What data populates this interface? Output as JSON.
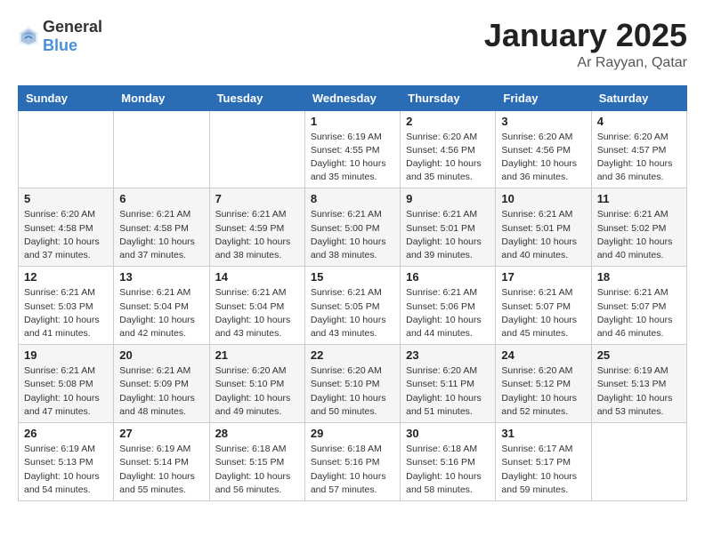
{
  "header": {
    "logo_general": "General",
    "logo_blue": "Blue",
    "title": "January 2025",
    "subtitle": "Ar Rayyan, Qatar"
  },
  "weekdays": [
    "Sunday",
    "Monday",
    "Tuesday",
    "Wednesday",
    "Thursday",
    "Friday",
    "Saturday"
  ],
  "weeks": [
    [
      {
        "day": "",
        "sunrise": "",
        "sunset": "",
        "daylight": ""
      },
      {
        "day": "",
        "sunrise": "",
        "sunset": "",
        "daylight": ""
      },
      {
        "day": "",
        "sunrise": "",
        "sunset": "",
        "daylight": ""
      },
      {
        "day": "1",
        "sunrise": "Sunrise: 6:19 AM",
        "sunset": "Sunset: 4:55 PM",
        "daylight": "Daylight: 10 hours and 35 minutes."
      },
      {
        "day": "2",
        "sunrise": "Sunrise: 6:20 AM",
        "sunset": "Sunset: 4:56 PM",
        "daylight": "Daylight: 10 hours and 35 minutes."
      },
      {
        "day": "3",
        "sunrise": "Sunrise: 6:20 AM",
        "sunset": "Sunset: 4:56 PM",
        "daylight": "Daylight: 10 hours and 36 minutes."
      },
      {
        "day": "4",
        "sunrise": "Sunrise: 6:20 AM",
        "sunset": "Sunset: 4:57 PM",
        "daylight": "Daylight: 10 hours and 36 minutes."
      }
    ],
    [
      {
        "day": "5",
        "sunrise": "Sunrise: 6:20 AM",
        "sunset": "Sunset: 4:58 PM",
        "daylight": "Daylight: 10 hours and 37 minutes."
      },
      {
        "day": "6",
        "sunrise": "Sunrise: 6:21 AM",
        "sunset": "Sunset: 4:58 PM",
        "daylight": "Daylight: 10 hours and 37 minutes."
      },
      {
        "day": "7",
        "sunrise": "Sunrise: 6:21 AM",
        "sunset": "Sunset: 4:59 PM",
        "daylight": "Daylight: 10 hours and 38 minutes."
      },
      {
        "day": "8",
        "sunrise": "Sunrise: 6:21 AM",
        "sunset": "Sunset: 5:00 PM",
        "daylight": "Daylight: 10 hours and 38 minutes."
      },
      {
        "day": "9",
        "sunrise": "Sunrise: 6:21 AM",
        "sunset": "Sunset: 5:01 PM",
        "daylight": "Daylight: 10 hours and 39 minutes."
      },
      {
        "day": "10",
        "sunrise": "Sunrise: 6:21 AM",
        "sunset": "Sunset: 5:01 PM",
        "daylight": "Daylight: 10 hours and 40 minutes."
      },
      {
        "day": "11",
        "sunrise": "Sunrise: 6:21 AM",
        "sunset": "Sunset: 5:02 PM",
        "daylight": "Daylight: 10 hours and 40 minutes."
      }
    ],
    [
      {
        "day": "12",
        "sunrise": "Sunrise: 6:21 AM",
        "sunset": "Sunset: 5:03 PM",
        "daylight": "Daylight: 10 hours and 41 minutes."
      },
      {
        "day": "13",
        "sunrise": "Sunrise: 6:21 AM",
        "sunset": "Sunset: 5:04 PM",
        "daylight": "Daylight: 10 hours and 42 minutes."
      },
      {
        "day": "14",
        "sunrise": "Sunrise: 6:21 AM",
        "sunset": "Sunset: 5:04 PM",
        "daylight": "Daylight: 10 hours and 43 minutes."
      },
      {
        "day": "15",
        "sunrise": "Sunrise: 6:21 AM",
        "sunset": "Sunset: 5:05 PM",
        "daylight": "Daylight: 10 hours and 43 minutes."
      },
      {
        "day": "16",
        "sunrise": "Sunrise: 6:21 AM",
        "sunset": "Sunset: 5:06 PM",
        "daylight": "Daylight: 10 hours and 44 minutes."
      },
      {
        "day": "17",
        "sunrise": "Sunrise: 6:21 AM",
        "sunset": "Sunset: 5:07 PM",
        "daylight": "Daylight: 10 hours and 45 minutes."
      },
      {
        "day": "18",
        "sunrise": "Sunrise: 6:21 AM",
        "sunset": "Sunset: 5:07 PM",
        "daylight": "Daylight: 10 hours and 46 minutes."
      }
    ],
    [
      {
        "day": "19",
        "sunrise": "Sunrise: 6:21 AM",
        "sunset": "Sunset: 5:08 PM",
        "daylight": "Daylight: 10 hours and 47 minutes."
      },
      {
        "day": "20",
        "sunrise": "Sunrise: 6:21 AM",
        "sunset": "Sunset: 5:09 PM",
        "daylight": "Daylight: 10 hours and 48 minutes."
      },
      {
        "day": "21",
        "sunrise": "Sunrise: 6:20 AM",
        "sunset": "Sunset: 5:10 PM",
        "daylight": "Daylight: 10 hours and 49 minutes."
      },
      {
        "day": "22",
        "sunrise": "Sunrise: 6:20 AM",
        "sunset": "Sunset: 5:10 PM",
        "daylight": "Daylight: 10 hours and 50 minutes."
      },
      {
        "day": "23",
        "sunrise": "Sunrise: 6:20 AM",
        "sunset": "Sunset: 5:11 PM",
        "daylight": "Daylight: 10 hours and 51 minutes."
      },
      {
        "day": "24",
        "sunrise": "Sunrise: 6:20 AM",
        "sunset": "Sunset: 5:12 PM",
        "daylight": "Daylight: 10 hours and 52 minutes."
      },
      {
        "day": "25",
        "sunrise": "Sunrise: 6:19 AM",
        "sunset": "Sunset: 5:13 PM",
        "daylight": "Daylight: 10 hours and 53 minutes."
      }
    ],
    [
      {
        "day": "26",
        "sunrise": "Sunrise: 6:19 AM",
        "sunset": "Sunset: 5:13 PM",
        "daylight": "Daylight: 10 hours and 54 minutes."
      },
      {
        "day": "27",
        "sunrise": "Sunrise: 6:19 AM",
        "sunset": "Sunset: 5:14 PM",
        "daylight": "Daylight: 10 hours and 55 minutes."
      },
      {
        "day": "28",
        "sunrise": "Sunrise: 6:18 AM",
        "sunset": "Sunset: 5:15 PM",
        "daylight": "Daylight: 10 hours and 56 minutes."
      },
      {
        "day": "29",
        "sunrise": "Sunrise: 6:18 AM",
        "sunset": "Sunset: 5:16 PM",
        "daylight": "Daylight: 10 hours and 57 minutes."
      },
      {
        "day": "30",
        "sunrise": "Sunrise: 6:18 AM",
        "sunset": "Sunset: 5:16 PM",
        "daylight": "Daylight: 10 hours and 58 minutes."
      },
      {
        "day": "31",
        "sunrise": "Sunrise: 6:17 AM",
        "sunset": "Sunset: 5:17 PM",
        "daylight": "Daylight: 10 hours and 59 minutes."
      },
      {
        "day": "",
        "sunrise": "",
        "sunset": "",
        "daylight": ""
      }
    ]
  ]
}
